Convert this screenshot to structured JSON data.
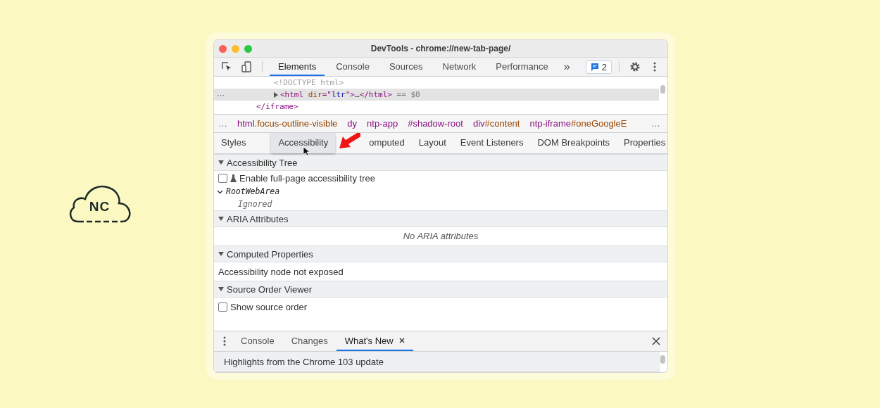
{
  "window": {
    "title": "DevTools - chrome://new-tab-page/"
  },
  "main_tabs": [
    {
      "label": "Elements",
      "selected": true
    },
    {
      "label": "Console",
      "selected": false
    },
    {
      "label": "Sources",
      "selected": false
    },
    {
      "label": "Network",
      "selected": false
    },
    {
      "label": "Performance",
      "selected": false
    }
  ],
  "more_tabs": "»",
  "issues_badge": "2",
  "dom_tree": [
    {
      "children": [
        {
          "tokens": [
            {
              "kind": "dim",
              "text": "<!DOCTYPE html>"
            }
          ],
          "selected": false,
          "expandable": false
        },
        {
          "tokens": [
            {
              "kind": "tag",
              "text": "<html "
            },
            {
              "kind": "attr",
              "text": "dir"
            },
            {
              "kind": "tag",
              "text": "=\""
            },
            {
              "kind": "val",
              "text": "ltr"
            },
            {
              "kind": "tag",
              "text": "\">"
            },
            {
              "kind": "plain",
              "text": "…"
            },
            {
              "kind": "tag",
              "text": "</html>"
            }
          ],
          "suffix": "== $0",
          "selected": true,
          "expandable": true,
          "gutter": "···"
        }
      ],
      "closing": [
        {
          "kind": "tag",
          "text": "</iframe>"
        }
      ]
    }
  ],
  "breadcrumbs": {
    "leading": "…",
    "trailing": "…",
    "items": [
      {
        "tag": "html",
        "rest": ".focus-outline-visible"
      },
      {
        "tag": "dy"
      },
      {
        "tag": "ntp-app"
      },
      {
        "tag": "#shadow-root"
      },
      {
        "tag": "div",
        "rest": "#content"
      },
      {
        "tag": "ntp-iframe",
        "rest": "#oneGoogleE"
      }
    ]
  },
  "sidebar_tabs": [
    {
      "label": "Styles",
      "kind": "tab",
      "selected": false
    },
    {
      "label": "Accessibility",
      "kind": "dragged",
      "selected": false
    },
    {
      "label": "omputed",
      "kind": "tab",
      "selected": false
    },
    {
      "label": "Layout",
      "kind": "tab",
      "selected": false
    },
    {
      "label": "Event Listeners",
      "kind": "tab",
      "selected": false
    },
    {
      "label": "DOM Breakpoints",
      "kind": "tab",
      "selected": false
    },
    {
      "label": "Properties",
      "kind": "tab",
      "selected": false
    }
  ],
  "sections": [
    {
      "title": "Accessibility Tree",
      "expanded": true,
      "rows": [
        {
          "kind": "checkbox",
          "label": "Enable full-page accessibility tree",
          "checked": false,
          "icon": true
        },
        {
          "kind": "node",
          "label": "RootWebArea",
          "expanded": true,
          "children": [
            {
              "kind": "node-note",
              "label": "Ignored"
            }
          ]
        }
      ]
    },
    {
      "title": "ARIA Attributes",
      "expanded": true,
      "rows": [
        {
          "kind": "empty",
          "label": "No ARIA attributes"
        }
      ]
    },
    {
      "title": "Computed Properties",
      "expanded": true,
      "rows": [
        {
          "kind": "text",
          "label": "Accessibility node not exposed"
        }
      ]
    },
    {
      "title": "Source Order Viewer",
      "expanded": true,
      "rows": [
        {
          "kind": "checkbox",
          "label": "Show source order",
          "checked": false,
          "icon": false
        }
      ]
    }
  ],
  "drawer": {
    "tabs": [
      {
        "label": "Console",
        "selected": false,
        "closable": false
      },
      {
        "label": "Changes",
        "selected": false,
        "closable": false
      },
      {
        "label": "What's New",
        "selected": true,
        "closable": true
      }
    ],
    "content": "Highlights from the Chrome 103 update"
  },
  "logo": {
    "text": "NC"
  }
}
